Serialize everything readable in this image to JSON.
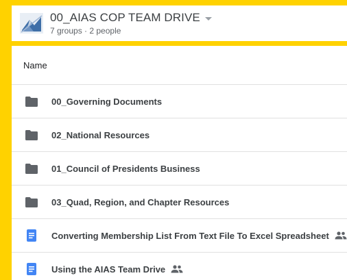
{
  "header": {
    "title": "00_AIAS COP TEAM DRIVE",
    "subtitle": "7 groups · 2 people",
    "logo_icon": "team-drive-logo-icon",
    "menu_icon": "chevron-down-icon"
  },
  "table": {
    "column_name": "Name"
  },
  "files": [
    {
      "name": "00_Governing Documents",
      "type": "folder",
      "icon": "folder-icon",
      "shared": false
    },
    {
      "name": "02_National Resources",
      "type": "folder",
      "icon": "folder-icon",
      "shared": false
    },
    {
      "name": "01_Council of Presidents Business",
      "type": "folder",
      "icon": "folder-icon",
      "shared": false
    },
    {
      "name": "03_Quad, Region, and Chapter Resources",
      "type": "folder",
      "icon": "folder-icon",
      "shared": false
    },
    {
      "name": "Converting Membership List From Text File To Excel Spreadsheet",
      "type": "doc",
      "icon": "google-doc-icon",
      "shared": true
    },
    {
      "name": "Using the AIAS Team Drive",
      "type": "doc",
      "icon": "google-doc-icon",
      "shared": true
    }
  ],
  "colors": {
    "background": "#ffd200",
    "folder": "#5f6368",
    "doc": "#4285f4"
  }
}
